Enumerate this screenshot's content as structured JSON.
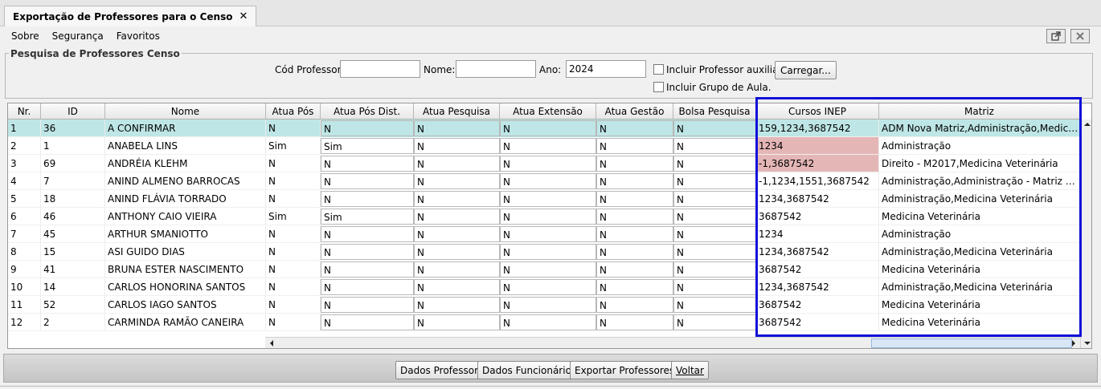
{
  "window": {
    "tab_title": "Exportação de Professores para o Censo"
  },
  "menu": {
    "items": [
      "Sobre",
      "Segurança",
      "Favoritos"
    ]
  },
  "search": {
    "legend": "Pesquisa de Professores Censo",
    "cod_label": "Cód Professor:",
    "cod_value": "",
    "nome_label": "Nome:",
    "nome_value": "",
    "ano_label": "Ano:",
    "ano_value": "2024",
    "aux_label": "Incluir Professor auxiliar.",
    "grupo_label": "Incluir Grupo de Aula.",
    "carregar_label": "Carregar..."
  },
  "table": {
    "headers": [
      "Nr.",
      "ID",
      "Nome",
      "Atua Pós",
      "Atua Pós Dist.",
      "Atua Pesquisa",
      "Atua Extensão",
      "Atua Gestão",
      "Bolsa Pesquisa",
      "Cursos INEP",
      "Matriz"
    ],
    "rows": [
      [
        "1",
        "36",
        "A CONFIRMAR",
        "N",
        "N",
        "N",
        "N",
        "N",
        "N",
        "159,1234,3687542",
        "ADM Nova Matriz,Administração,Medicina V..."
      ],
      [
        "2",
        "1",
        "ANABELA LINS",
        "Sim",
        "Sim",
        "N",
        "N",
        "N",
        "N",
        "1234",
        "Administração"
      ],
      [
        "3",
        "69",
        "ANDRÉIA KLEHM",
        "N",
        "N",
        "N",
        "N",
        "N",
        "N",
        "-1,3687542",
        "Direito - M2017,Medicina Veterinária"
      ],
      [
        "4",
        "7",
        "ANIND ALMENO BARROCAS",
        "N",
        "N",
        "N",
        "N",
        "N",
        "N",
        "-1,1234,1551,3687542",
        "Administração,Administração - Matriz Curric..."
      ],
      [
        "5",
        "18",
        "ANIND FLÁVIA TORRADO",
        "N",
        "N",
        "N",
        "N",
        "N",
        "N",
        "1234,3687542",
        "Administração,Medicina Veterinária"
      ],
      [
        "6",
        "46",
        "ANTHONY CAIO VIEIRA",
        "Sim",
        "Sim",
        "N",
        "N",
        "N",
        "N",
        "3687542",
        "Medicina Veterinária"
      ],
      [
        "7",
        "45",
        "ARTHUR SMANIOTTO",
        "N",
        "N",
        "N",
        "N",
        "N",
        "N",
        "1234",
        "Administração"
      ],
      [
        "8",
        "15",
        "ASI GUIDO DIAS",
        "N",
        "N",
        "N",
        "N",
        "N",
        "N",
        "1234,3687542",
        "Administração,Medicina Veterinária"
      ],
      [
        "9",
        "41",
        "BRUNA ESTER NASCIMENTO",
        "N",
        "N",
        "N",
        "N",
        "N",
        "N",
        "3687542",
        "Medicina Veterinária"
      ],
      [
        "10",
        "14",
        "CARLOS HONORINA SANTOS",
        "N",
        "N",
        "N",
        "N",
        "N",
        "N",
        "1234,3687542",
        "Administração,Medicina Veterinária"
      ],
      [
        "11",
        "52",
        "CARLOS IAGO SANTOS",
        "N",
        "N",
        "N",
        "N",
        "N",
        "N",
        "3687542",
        "Medicina Veterinária"
      ],
      [
        "12",
        "2",
        "CARMINDA RAMÃO CANEIRA",
        "N",
        "N",
        "N",
        "N",
        "N",
        "N",
        "3687542",
        "Medicina Veterinária"
      ]
    ],
    "highlighted_rows": [
      2,
      3
    ]
  },
  "buttons": {
    "dados_professor": "Dados Professor",
    "dados_funcionario": "Dados Funcionário",
    "exportar": "Exportar Professores",
    "voltar": "Voltar"
  },
  "colors": {
    "selected_row": "#bfe6e6",
    "error_cell": "#e5b6b6",
    "highlight_box": "#1010d8"
  }
}
